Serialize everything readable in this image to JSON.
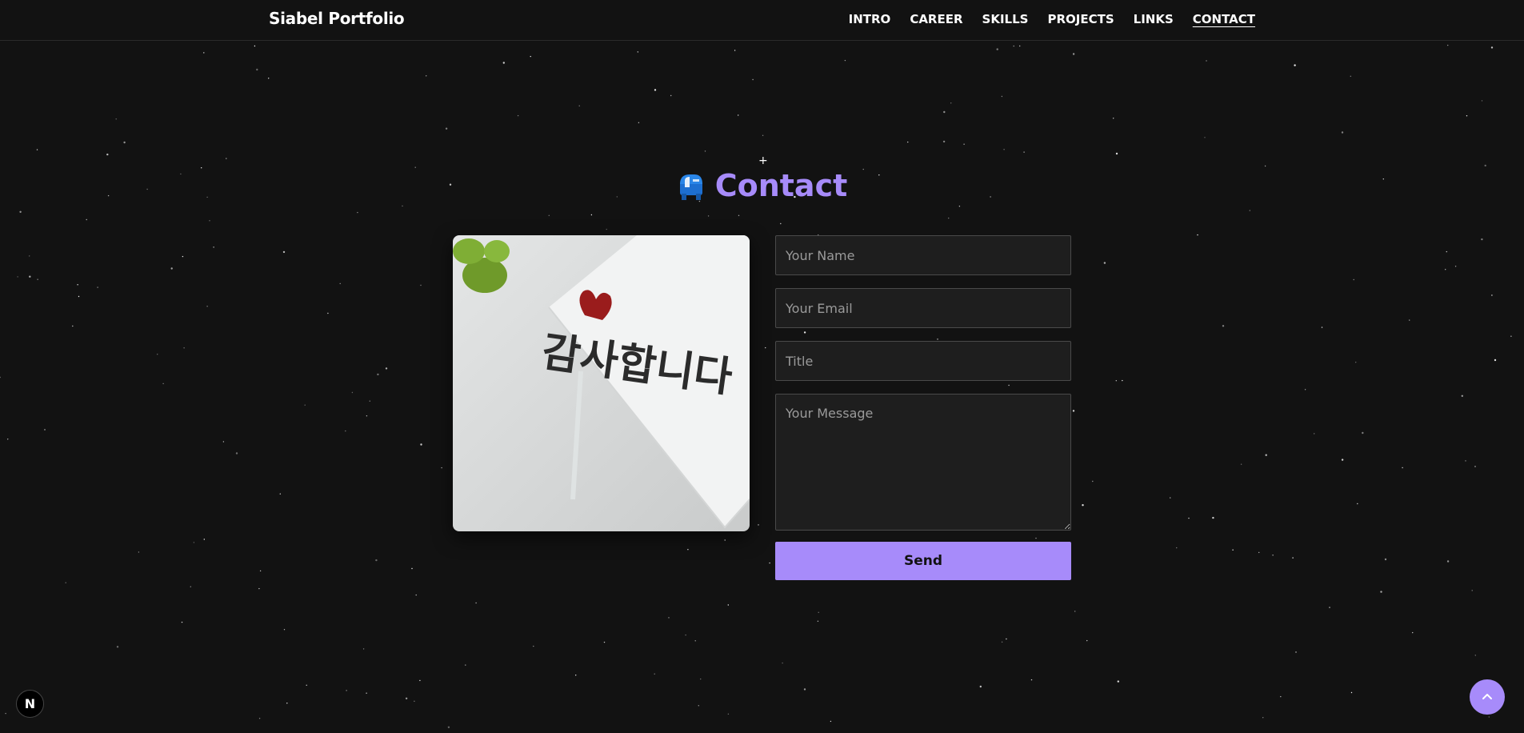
{
  "header": {
    "brand": "Siabel Portfolio",
    "nav": [
      {
        "label": "INTRO",
        "active": false
      },
      {
        "label": "CAREER",
        "active": false
      },
      {
        "label": "SKILLS",
        "active": false
      },
      {
        "label": "PROJECTS",
        "active": false
      },
      {
        "label": "LINKS",
        "active": false
      },
      {
        "label": "CONTACT",
        "active": true
      }
    ]
  },
  "contact": {
    "icon": "mailbox-icon",
    "title": "Contact",
    "photo_text": "감사합니다",
    "form": {
      "name_placeholder": "Your Name",
      "email_placeholder": "Your Email",
      "title_placeholder": "Title",
      "message_placeholder": "Your Message",
      "send_label": "Send"
    }
  },
  "floating": {
    "dev_badge": "N",
    "scroll_top_icon": "chevron-up-icon"
  },
  "colors": {
    "background": "#121212",
    "accent": "#a78bfa",
    "field_bg": "#1e1e1e"
  }
}
